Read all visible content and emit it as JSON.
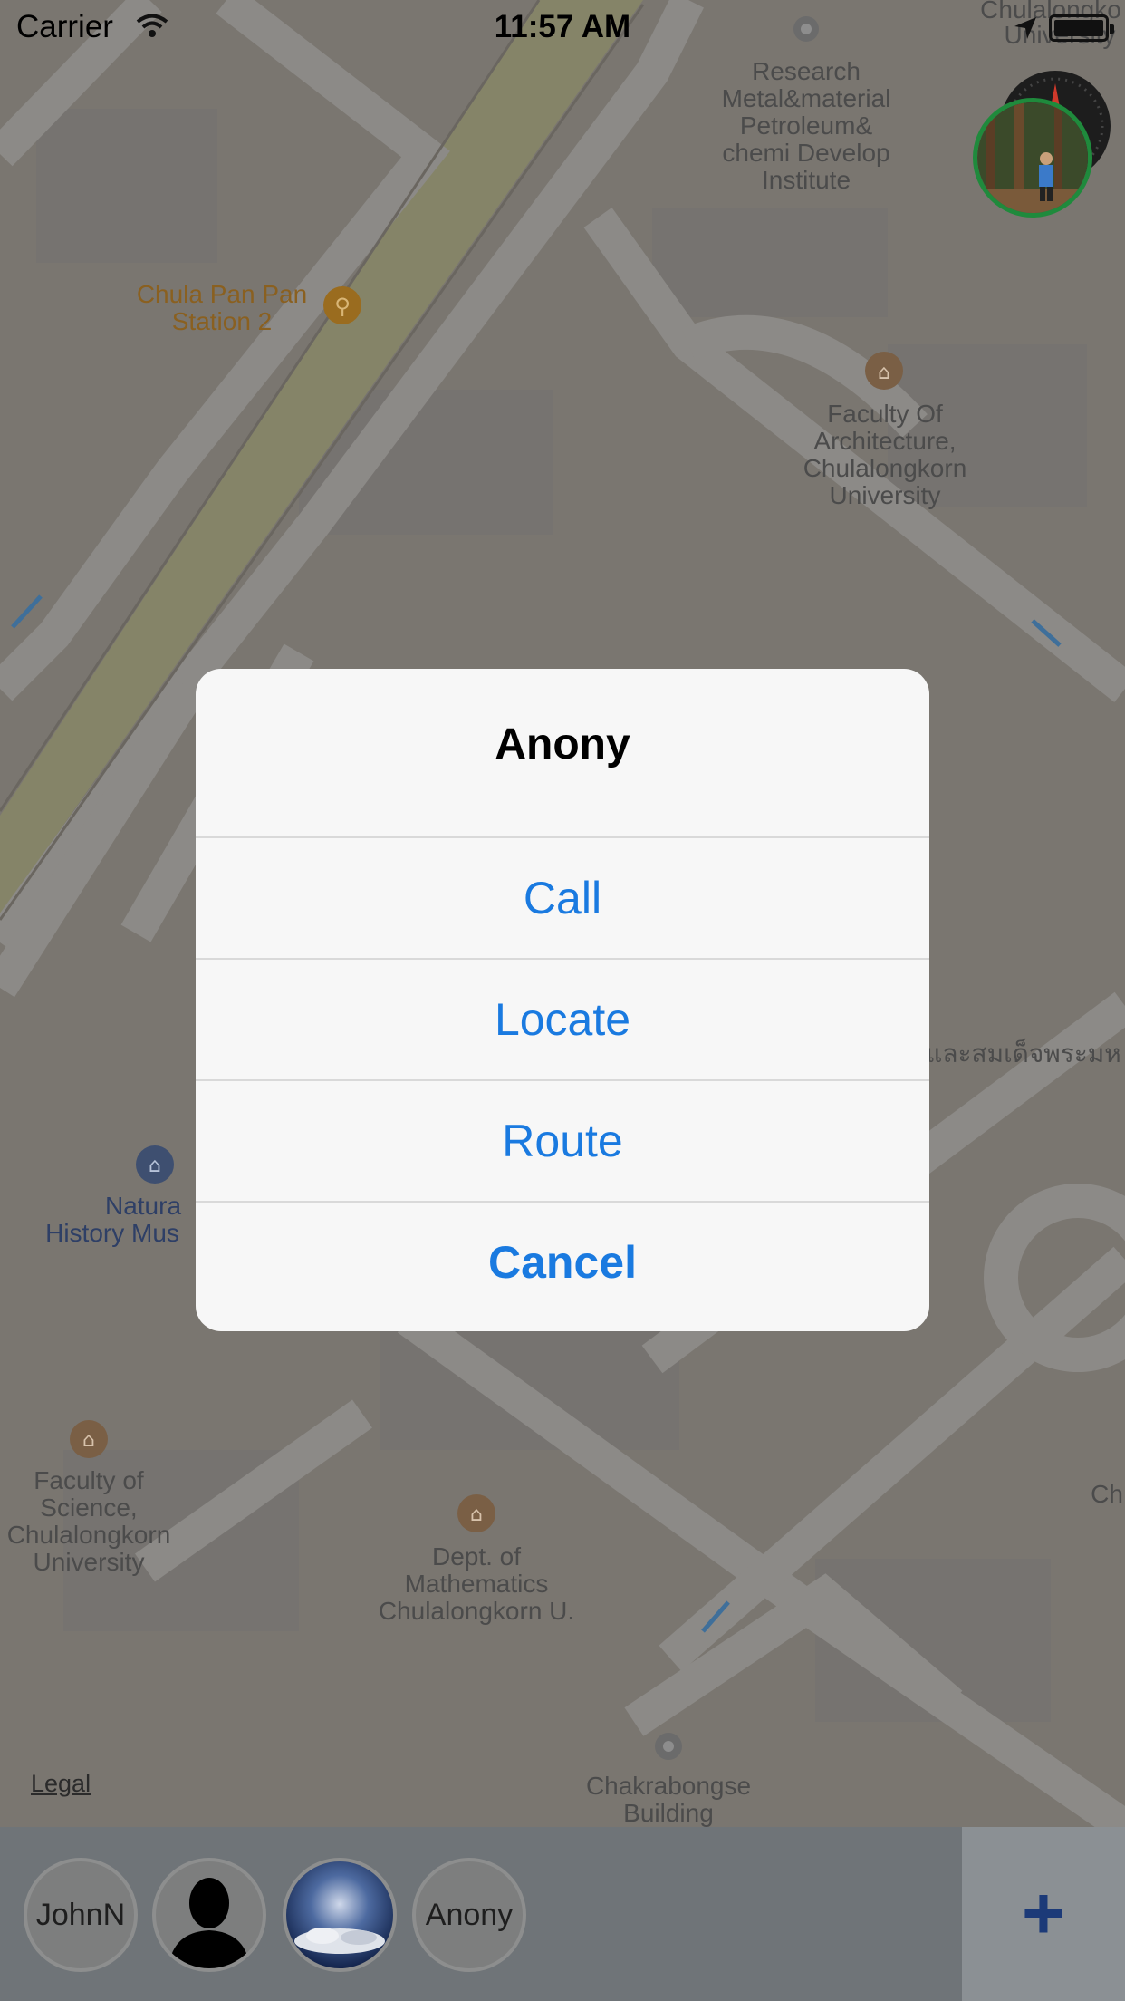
{
  "status_bar": {
    "carrier": "Carrier",
    "time": "11:57 AM"
  },
  "map": {
    "labels": [
      {
        "name": "research-institute",
        "lines": [
          "Research",
          "Metal&material",
          "Petroleum&",
          "chemi Develop",
          "Institute"
        ]
      },
      {
        "name": "chula-pan-pan",
        "lines": [
          "Chula Pan Pan",
          "Station 2"
        ]
      },
      {
        "name": "faculty-architecture",
        "lines": [
          "Faculty Of",
          "Architecture,",
          "Chulalongkorn",
          "University"
        ]
      },
      {
        "name": "natural-history",
        "lines": [
          "Natura",
          "History Mus"
        ]
      },
      {
        "name": "faculty-science",
        "lines": [
          "Faculty of",
          "Science,",
          "Chulalongkorn",
          "University"
        ]
      },
      {
        "name": "dept-math",
        "lines": [
          "Dept. of",
          "Mathematics",
          "Chulalongkorn U."
        ]
      },
      {
        "name": "chakrabongse",
        "lines": [
          "Chakrabongse",
          "Building"
        ]
      },
      {
        "name": "chula-top",
        "lines": [
          "Chulalongko",
          "University"
        ]
      },
      {
        "name": "thai-road",
        "lines": [
          "และสมเด็จพระมห"
        ]
      },
      {
        "name": "ch-right",
        "lines": [
          "Ch"
        ]
      }
    ],
    "legal": "Legal"
  },
  "alert": {
    "title": "Anony",
    "actions": [
      "Call",
      "Locate",
      "Route"
    ],
    "cancel": "Cancel"
  },
  "contacts": [
    {
      "label": "JohnN"
    },
    {
      "label": ""
    },
    {
      "label": ""
    },
    {
      "label": "Anony"
    }
  ],
  "add_button": "+"
}
